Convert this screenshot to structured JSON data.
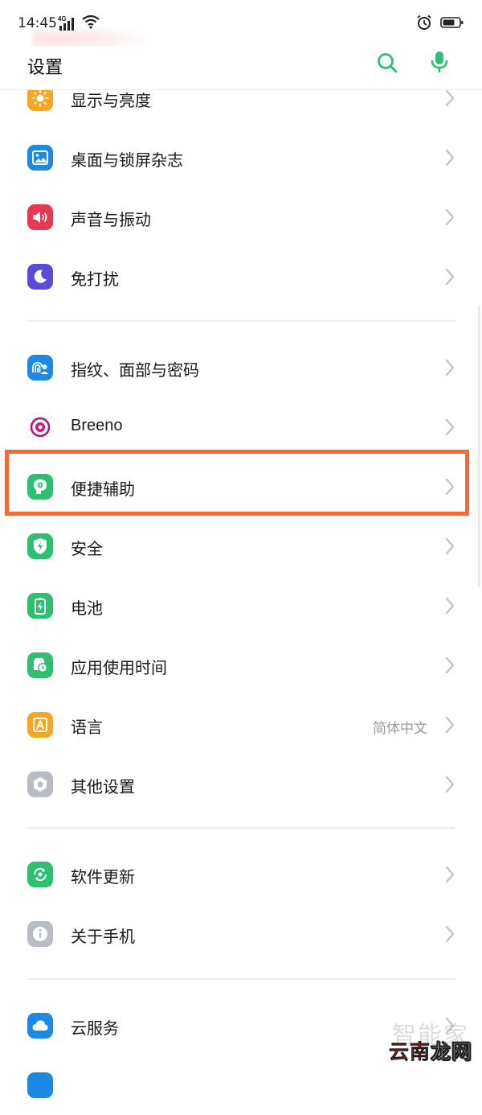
{
  "status_bar": {
    "time": "14:45",
    "network": "4G",
    "left_icons": [
      "signal-icon",
      "wifi-icon"
    ],
    "right_icons": [
      "alarm-icon",
      "battery-icon"
    ]
  },
  "header": {
    "title": "设置",
    "search_icon": "search-icon",
    "voice_icon": "microphone-icon",
    "accent": "#2fbf71"
  },
  "sections": [
    {
      "items": [
        {
          "label": "显示与亮度",
          "icon": "brightness-icon",
          "color": "#f5a623"
        },
        {
          "label": "桌面与锁屏杂志",
          "icon": "wallpaper-icon",
          "color": "#1e88e5"
        },
        {
          "label": "声音与振动",
          "icon": "speaker-icon",
          "color": "#e53950"
        },
        {
          "label": "免打扰",
          "icon": "moon-icon",
          "color": "#5b4bd6"
        }
      ]
    },
    {
      "items": [
        {
          "label": "指纹、面部与密码",
          "icon": "fingerprint-face-icon",
          "color": "#1e88e5"
        },
        {
          "label": "Breeno",
          "icon": "breeno-icon",
          "color": "#b0127a"
        },
        {
          "label": "便捷辅助",
          "icon": "assist-head-icon",
          "color": "#2fbf71",
          "highlighted": true
        },
        {
          "label": "安全",
          "icon": "shield-icon",
          "color": "#2fbf71"
        },
        {
          "label": "电池",
          "icon": "battery-charge-icon",
          "color": "#2fbf71"
        },
        {
          "label": "应用使用时间",
          "icon": "app-timer-icon",
          "color": "#2fbf71"
        },
        {
          "label": "语言",
          "icon": "language-icon",
          "color": "#f5a623",
          "value": "简体中文"
        },
        {
          "label": "其他设置",
          "icon": "hexagon-nut-icon",
          "color": "#b8bcc4"
        }
      ]
    },
    {
      "items": [
        {
          "label": "软件更新",
          "icon": "update-icon",
          "color": "#2fbf71"
        },
        {
          "label": "关于手机",
          "icon": "info-icon",
          "color": "#b8bcc4"
        }
      ]
    },
    {
      "items": [
        {
          "label": "云服务",
          "icon": "cloud-icon",
          "color": "#1e88e5"
        }
      ]
    }
  ],
  "watermark": {
    "faint": "智能家",
    "brand_a": "云南",
    "brand_b": "龙网"
  }
}
